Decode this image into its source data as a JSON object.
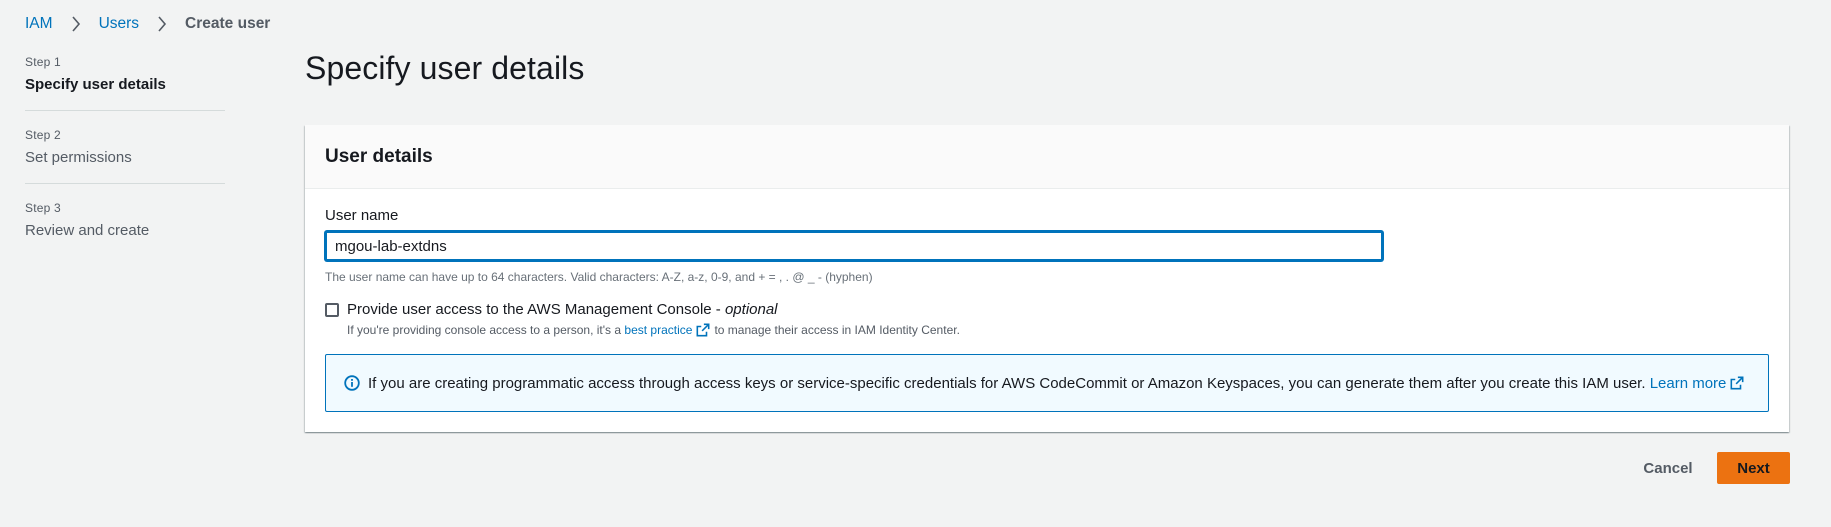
{
  "breadcrumb": {
    "items": [
      {
        "label": "IAM"
      },
      {
        "label": "Users"
      },
      {
        "label": "Create user"
      }
    ]
  },
  "steps": [
    {
      "number": "Step 1",
      "title": "Specify user details",
      "active": true
    },
    {
      "number": "Step 2",
      "title": "Set permissions",
      "active": false
    },
    {
      "number": "Step 3",
      "title": "Review and create",
      "active": false
    }
  ],
  "page_title": "Specify user details",
  "user_details": {
    "title": "User details",
    "user_name_label": "User name",
    "user_name_value": "mgou-lab-extdns",
    "constraint_text": "The user name can have up to 64 characters. Valid characters: A-Z, a-z, 0-9, and + = , . @ _ - (hyphen)",
    "console_access": {
      "label": "Provide user access to the AWS Management Console - ",
      "label_optional": "optional",
      "checked": false,
      "desc_before": "If you're providing console access to a person, it's a",
      "desc_link": "best practice",
      "desc_after": "to manage their access in IAM Identity Center."
    },
    "info_alert": {
      "text": "If you are creating programmatic access through access keys or service-specific credentials for AWS CodeCommit or Amazon Keyspaces, you can generate them after you create this IAM user.",
      "link": "Learn more"
    }
  },
  "actions": {
    "cancel_label": "Cancel",
    "next_label": "Next"
  },
  "colors": {
    "link": "#0073bb",
    "primary_button": "#ec7211",
    "background": "#f2f3f3",
    "info_bg": "#f1faff"
  },
  "icons": [
    "chevron-right-icon",
    "external-link-icon",
    "info-icon"
  ]
}
